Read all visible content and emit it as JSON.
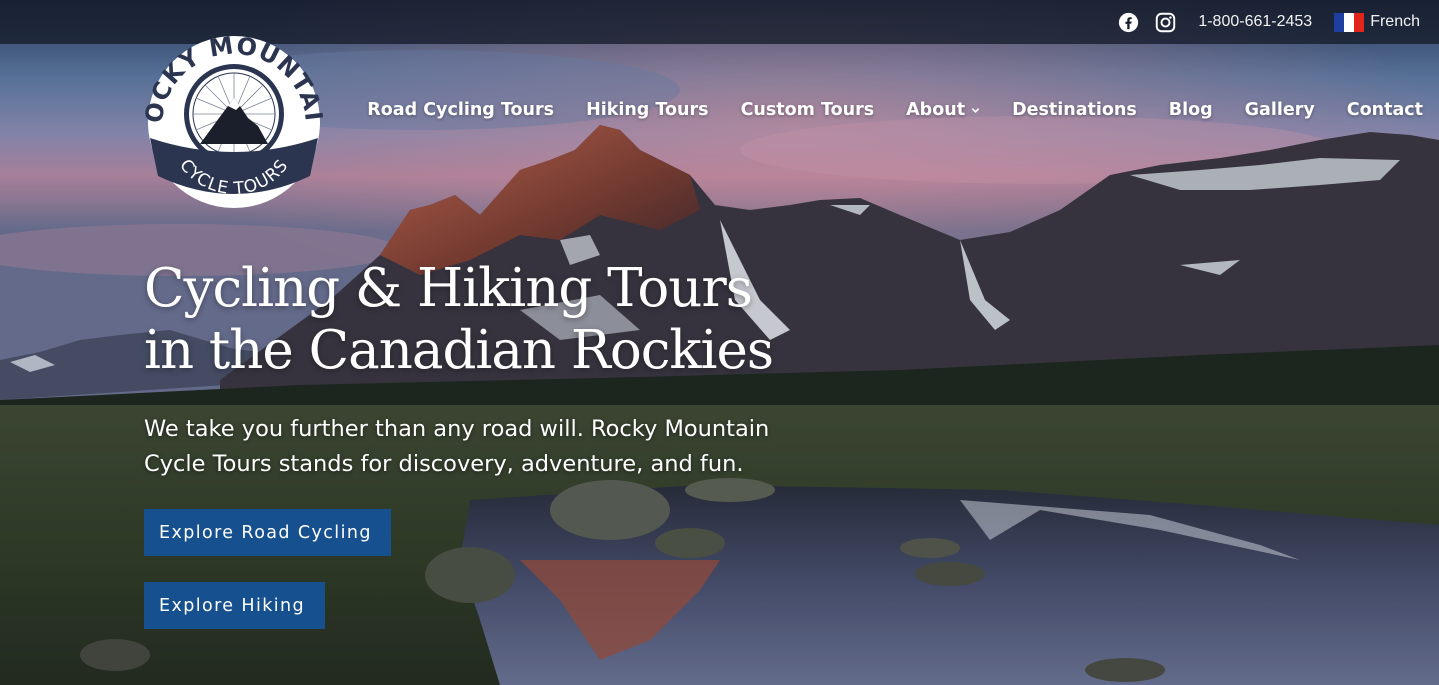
{
  "topbar": {
    "icons": [
      "facebook-icon",
      "instagram-icon"
    ],
    "phone": "1-800-661-2453",
    "language": "French",
    "flag_colors": [
      "#1f3fa0",
      "#ffffff",
      "#e1251b"
    ]
  },
  "logo": {
    "top_text": "ROCKY MOUNTAIN",
    "bottom_text": "CYCLE TOURS"
  },
  "nav": {
    "items": [
      {
        "label": "Road Cycling Tours"
      },
      {
        "label": "Hiking Tours"
      },
      {
        "label": "Custom Tours"
      },
      {
        "label": "About",
        "has_dropdown": true
      },
      {
        "label": "Destinations"
      },
      {
        "label": "Blog"
      },
      {
        "label": "Gallery"
      },
      {
        "label": "Contact"
      }
    ]
  },
  "hero": {
    "headline_line1": "Cycling & Hiking Tours",
    "headline_line2": "in the Canadian Rockies",
    "subline_line1": "We take you further than any road will. Rocky Mountain",
    "subline_line2": "Cycle Tours stands for discovery, adventure, and fun.",
    "cta_road": "Explore Road Cycling",
    "cta_hiking": "Explore Hiking"
  },
  "colors": {
    "button": "#17508f",
    "topbar": "#161c2a"
  }
}
